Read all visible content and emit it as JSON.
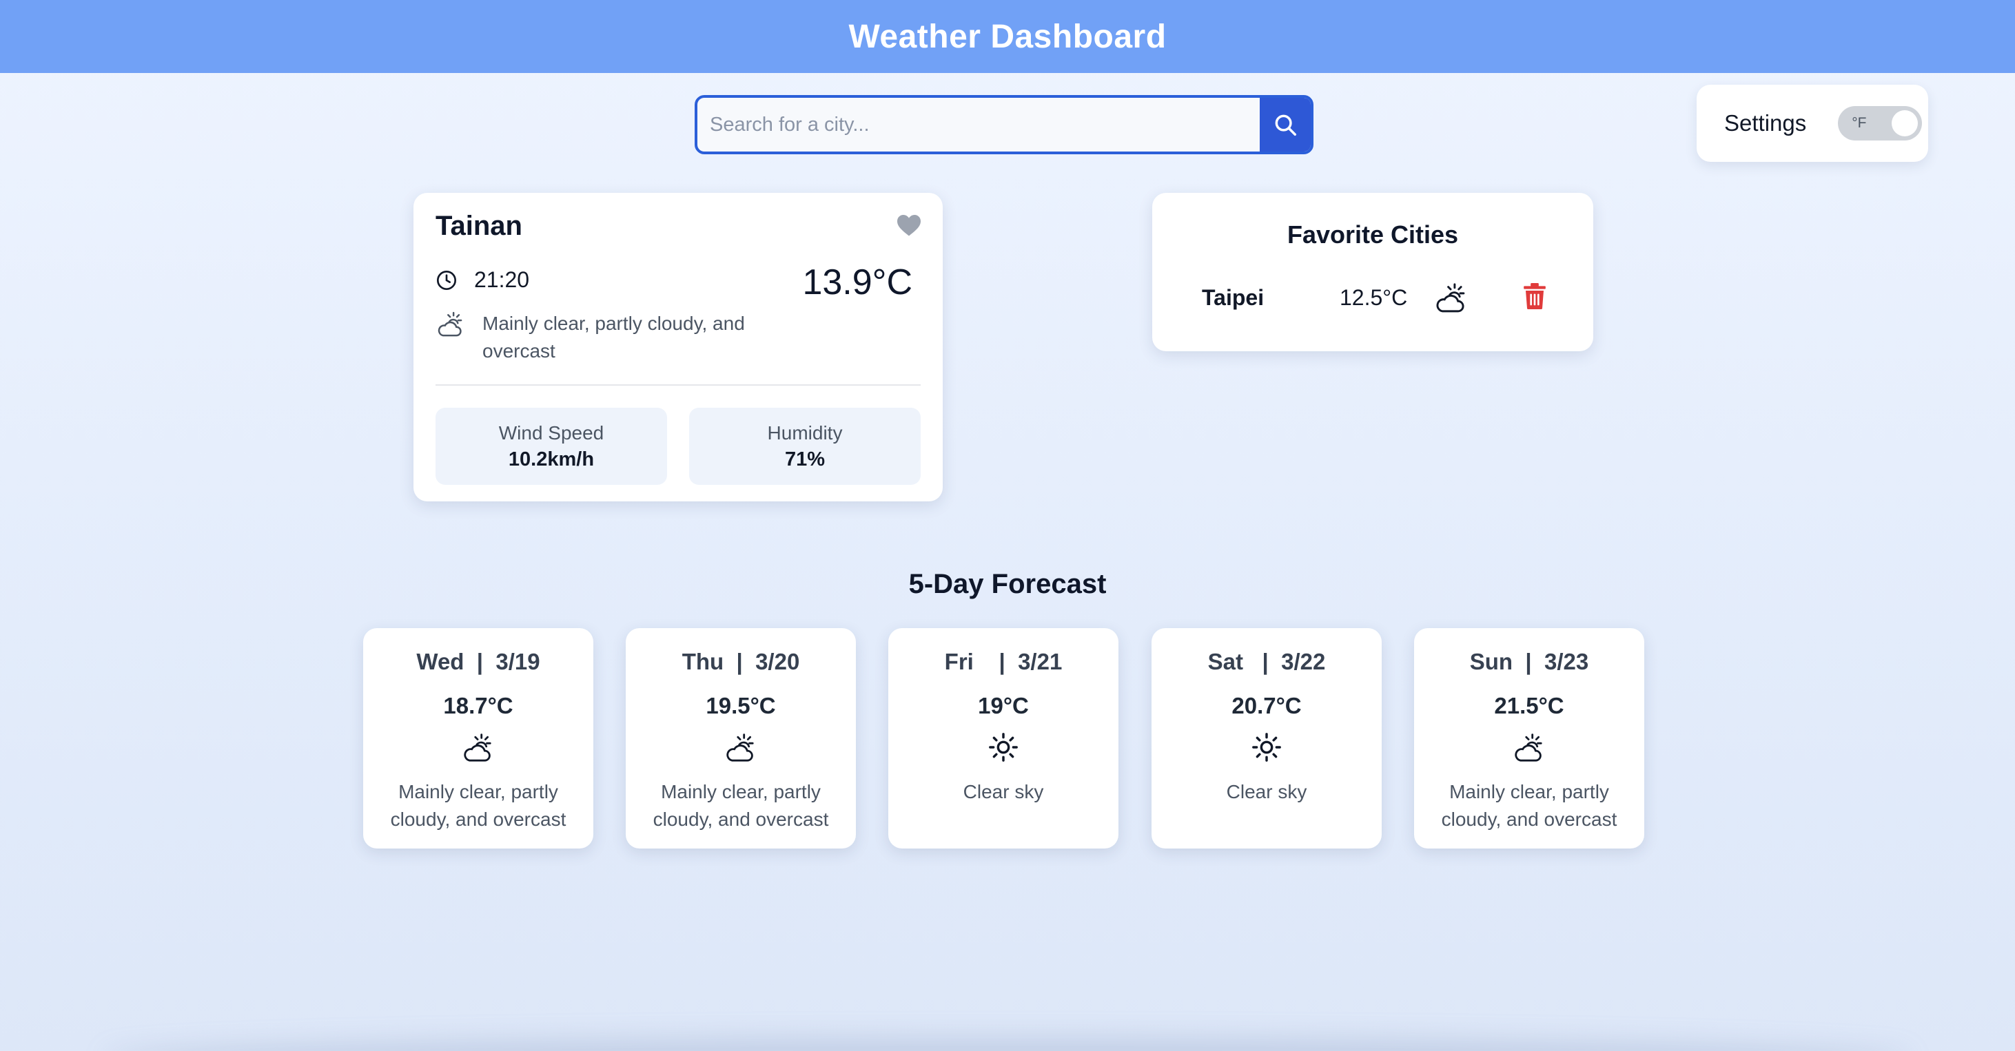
{
  "header": {
    "title": "Weather Dashboard"
  },
  "search": {
    "placeholder": "Search for a city...",
    "value": ""
  },
  "settings": {
    "label": "Settings",
    "unit_toggle_label": "°F",
    "unit_toggle_on": false
  },
  "current": {
    "city": "Tainan",
    "time": "21:20",
    "temperature": "13.9°C",
    "description": "Mainly clear, partly cloudy, and overcast",
    "icon": "partly-cloudy-icon",
    "wind": {
      "label": "Wind Speed",
      "value": "10.2km/h"
    },
    "humidity": {
      "label": "Humidity",
      "value": "71%"
    }
  },
  "favorites": {
    "title": "Favorite Cities",
    "items": [
      {
        "name": "Taipei",
        "temperature": "12.5°C",
        "icon": "partly-cloudy-icon"
      }
    ]
  },
  "forecast": {
    "title": "5-Day Forecast",
    "days": [
      {
        "date": "Wed  |  3/19",
        "temperature": "18.7°C",
        "icon": "partly-cloudy-icon",
        "description": "Mainly clear, partly cloudy, and overcast"
      },
      {
        "date": "Thu  |  3/20",
        "temperature": "19.5°C",
        "icon": "partly-cloudy-icon",
        "description": "Mainly clear, partly cloudy, and overcast"
      },
      {
        "date": "Fri    |  3/21",
        "temperature": "19°C",
        "icon": "sun-icon",
        "description": "Clear sky"
      },
      {
        "date": "Sat   |  3/22",
        "temperature": "20.7°C",
        "icon": "sun-icon",
        "description": "Clear sky"
      },
      {
        "date": "Sun  |  3/23",
        "temperature": "21.5°C",
        "icon": "partly-cloudy-icon",
        "description": "Mainly clear, partly cloudy, and overcast"
      }
    ]
  },
  "colors": {
    "header": "#71a1f6",
    "accent": "#2e58d6",
    "delete": "#e03b3b",
    "heart": "#9ca3af"
  }
}
